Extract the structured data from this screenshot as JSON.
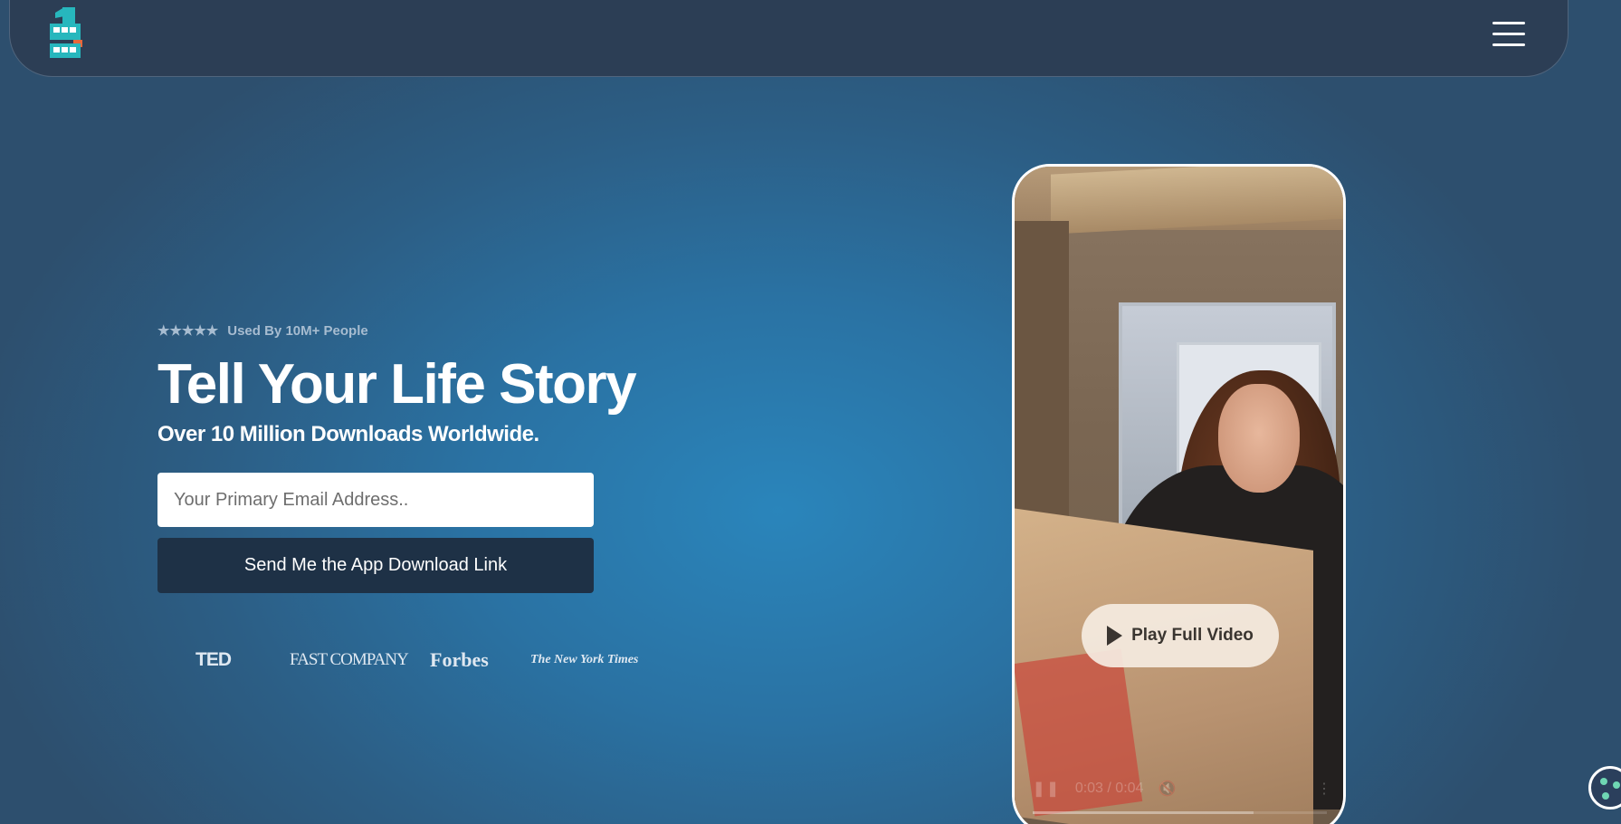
{
  "nav": {
    "logo_icon": "brand-logo-icon",
    "menu_icon": "hamburger-menu-icon"
  },
  "hero": {
    "stars": "★★★★★",
    "rating_text": "Used By 10M+ People",
    "title": "Tell Your Life Story",
    "subtitle": "Over 10 Million Downloads Worldwide.",
    "email_placeholder": "Your Primary Email Address..",
    "email_value": "",
    "cta_label": "Send Me the App Download Link"
  },
  "press": [
    "TED",
    "FAST COMPANY",
    "Forbes",
    "The New York Times"
  ],
  "video": {
    "play_label": "Play Full Video",
    "time": "0:03 / 0:04",
    "progress": 0.75
  },
  "colors": {
    "nav_bg": "#2c3e55",
    "cta_bg": "#1e3146",
    "accent": "#2a85bb"
  }
}
